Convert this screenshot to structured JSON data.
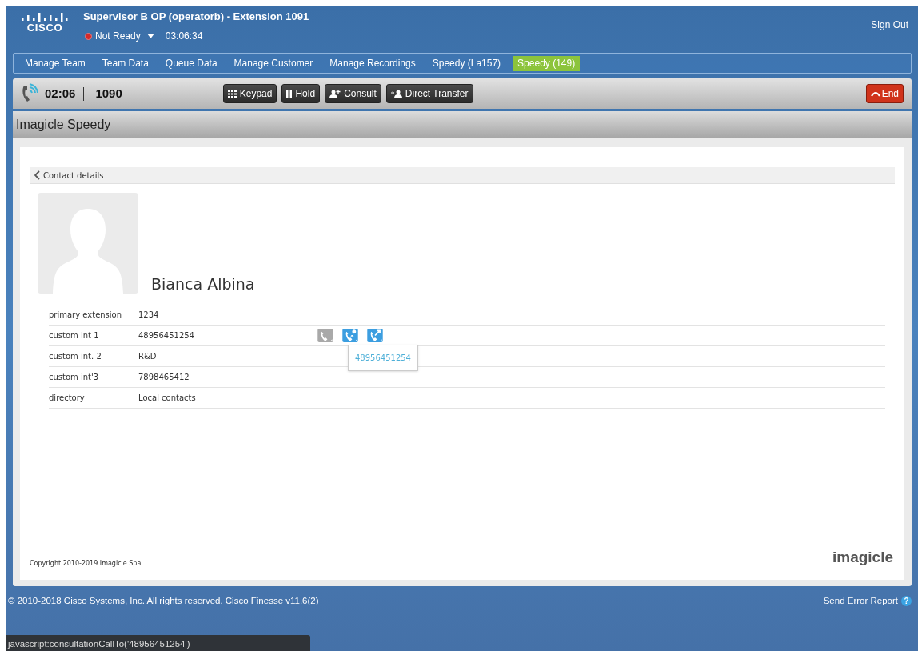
{
  "header": {
    "logo_text": "CISCO",
    "title": "Supervisor B OP (operatorb) - Extension 1091",
    "state": {
      "label": "Not Ready",
      "ready": false
    },
    "state_timer": "03:06:34",
    "sign_out": "Sign Out"
  },
  "nav_tabs": [
    {
      "label": "Manage Team",
      "selected": false
    },
    {
      "label": "Team Data",
      "selected": false
    },
    {
      "label": "Queue Data",
      "selected": false
    },
    {
      "label": "Manage Customer",
      "selected": false
    },
    {
      "label": "Manage Recordings",
      "selected": false
    },
    {
      "label": "Speedy (La157)",
      "selected": false
    },
    {
      "label": "Speedy (149)",
      "selected": true
    }
  ],
  "call_bar": {
    "duration": "02:06",
    "number": "1090",
    "buttons": [
      {
        "kind": "keypad",
        "label": "Keypad"
      },
      {
        "kind": "hold",
        "label": "Hold"
      },
      {
        "kind": "consult",
        "label": "Consult"
      },
      {
        "kind": "transfer",
        "label": "Direct Transfer"
      }
    ],
    "end_button": "End"
  },
  "gadget": {
    "title": "Imagicle Speedy",
    "back_label": "Contact details",
    "contact_name": "Bianca Albina",
    "fields": [
      {
        "label": "primary extension",
        "value": "1234"
      },
      {
        "label": "custom int 1",
        "value": "48956451254",
        "actions": [
          {
            "kind": "call",
            "enabled": false
          },
          {
            "kind": "consult",
            "enabled": true
          },
          {
            "kind": "transfer",
            "enabled": true
          }
        ],
        "tooltip": "48956451254"
      },
      {
        "label": "custom int. 2",
        "value": "R&D"
      },
      {
        "label": "custom int'3",
        "value": "7898465412"
      },
      {
        "label": "directory",
        "value": "Local contacts"
      }
    ],
    "copyright": "Copyright 2010-2019 Imagicle Spa",
    "brand": "imagicle"
  },
  "footer": {
    "copyright": "© 2010-2018 Cisco Systems, Inc. All rights reserved. Cisco Finesse v11.6(2)",
    "error_report": "Send Error Report",
    "help_glyph": "?"
  },
  "status_url": "javascript:consultationCallTo('48956451254')"
}
